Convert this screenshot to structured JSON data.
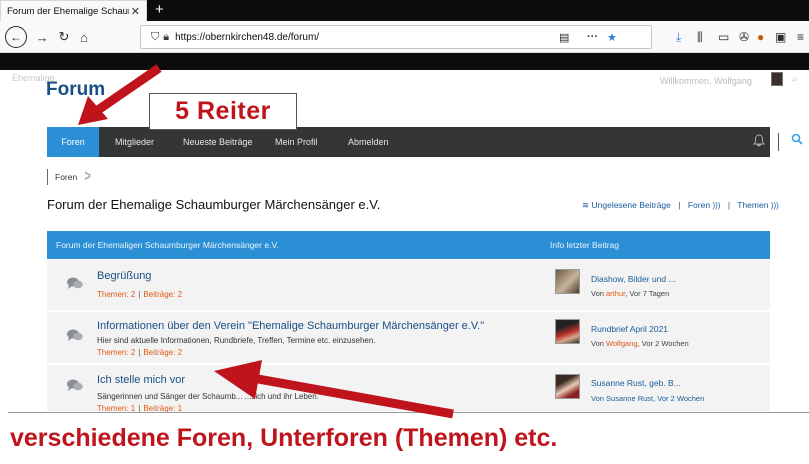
{
  "browser": {
    "tab_title": "Forum der Ehemalige Schaumburg",
    "tab_close": "✕",
    "new_tab": "+",
    "url": "https://obernkirchen48.de/forum/",
    "url_more": "···"
  },
  "site": {
    "logo": "Forum",
    "ghost_left": "Ehemalige",
    "welcome": "Willkommen, Wolfgang"
  },
  "annotations": {
    "tabs_callout": "5 Reiter",
    "forums_callout": "verschiedene Foren, Unterforen (Themen) etc."
  },
  "nav": {
    "items": [
      {
        "label": "Foren",
        "active": true
      },
      {
        "label": "Mitglieder",
        "active": false
      },
      {
        "label": "Neueste Beiträge",
        "active": false
      },
      {
        "label": "Mein Profil",
        "active": false
      },
      {
        "label": "Abmelden",
        "active": false
      }
    ]
  },
  "breadcrumb": {
    "current": "Foren"
  },
  "page": {
    "title": "Forum der Ehemalige Schaumburger Märchensänger e.V.",
    "links": {
      "unread": "Ungelesene Beiträge",
      "forums": "Foren",
      "topics": "Themen",
      "separator": "|"
    }
  },
  "table": {
    "header_left": "Forum der Ehemaligen Schaumburger Märchensänger e.V.",
    "header_right": "Info letzter Beitrag",
    "rows": [
      {
        "title": "Begrüßung",
        "description": "",
        "threads_label": "Themen: 2",
        "posts_label": "Beiträge: 2",
        "last_title": "Diashow, Bilder und ...",
        "last_by": "Von ",
        "last_author": "arthur",
        "last_when": ", Vor 7 Tagen"
      },
      {
        "title": "Informationen über den Verein \"Ehemalige Schaumburger Märchensänger e.V.\"",
        "description": "Hier sind aktuelle Informationen, Rundbriefe, Treffen, Termine etc. einzusehen.",
        "threads_label": "Themen: 2",
        "posts_label": "Beiträge: 2",
        "last_title": "Rundbrief April 2021",
        "last_by": "Von ",
        "last_author": "Wolfgang",
        "last_when": ", Vor 2 Wochen"
      },
      {
        "title": "Ich stelle mich vor",
        "description": "Sängerinnen und Sänger der Schaumb... ...sich und ihr Leben.",
        "threads_label": "Themen: 1",
        "posts_label": "Beiträge: 1",
        "last_title": "Susanne Rust, geb. B...",
        "last_by": "Von Susanne Rust, Vor 2 Wochen",
        "last_author": "",
        "last_when": ""
      }
    ]
  },
  "colors": {
    "accent": "#2b8fd6",
    "nav_bg": "#333537",
    "annotation_red": "#c0141c",
    "stats_orange": "#e25a17"
  },
  "icons": {
    "forum_row": "speech-bubbles-icon",
    "bell": "bell-icon",
    "search": "search-icon"
  }
}
